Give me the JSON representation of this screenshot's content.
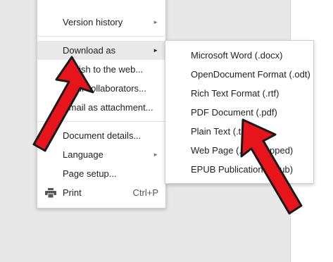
{
  "menu": {
    "items": [
      {
        "label": "Version history",
        "has_submenu": true
      },
      {
        "label": "Download as",
        "has_submenu": true
      },
      {
        "label": "Publish to the web...",
        "visible_text": "blish to the web..."
      },
      {
        "label": "Email collaborators...",
        "visible_text": "ail collaborators..."
      },
      {
        "label": "Email as attachment..."
      },
      {
        "label": "Document details..."
      },
      {
        "label": "Language",
        "has_submenu": true
      },
      {
        "label": "Page setup..."
      },
      {
        "label": "Print",
        "shortcut": "Ctrl+P",
        "icon": "printer-icon"
      }
    ],
    "submenu_arrow": "►"
  },
  "download_submenu": {
    "items": [
      {
        "label": "Microsoft Word (.docx)"
      },
      {
        "label": "OpenDocument Format (.odt)"
      },
      {
        "label": "Rich Text Format (.rtf)"
      },
      {
        "label": "PDF Document (.pdf)"
      },
      {
        "label": "Plain Text (.txt)",
        "visible_text": "Plain Text (.t"
      },
      {
        "label": "Web Page (.html, zipped)",
        "visible_text": "Web Page (.h",
        "visible_tail": "pped)"
      },
      {
        "label": "EPUB Publication (.epub)",
        "visible_text": "EPUB Publication",
        "visible_tail": "pub)"
      }
    ]
  },
  "colors": {
    "annotation_arrow": "#e8141b",
    "highlight": "#e9e9e9"
  }
}
